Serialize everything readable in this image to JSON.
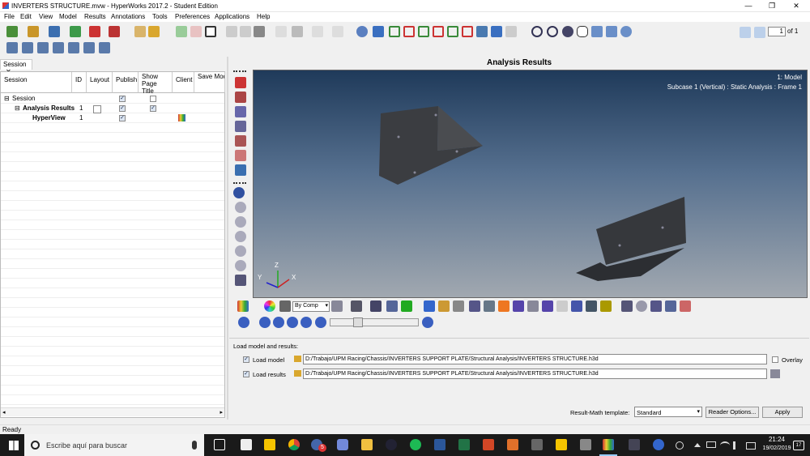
{
  "window": {
    "title": "INVERTERS STRUCTURE.mvw - HyperWorks 2017.2 - Student Edition",
    "min": "—",
    "max": "❐",
    "close": "✕"
  },
  "menu": [
    "File",
    "Edit",
    "View",
    "Model",
    "Results",
    "Annotations",
    "Tools",
    "Preferences",
    "Applications",
    "Help"
  ],
  "toolbar": {
    "page_current": "1",
    "page_total": "of 1"
  },
  "session": {
    "tab": "Session",
    "tab_close": "✕",
    "columns": [
      "Session",
      "ID",
      "Layout",
      "Publish",
      "Show Page Title",
      "Client",
      "Save Model File"
    ],
    "rows": [
      {
        "name": "Session",
        "id": "",
        "layout": null,
        "publish": true,
        "show_title": false,
        "client": ""
      },
      {
        "name": "Analysis Results",
        "id": "1",
        "layout": false,
        "publish": true,
        "show_title": true,
        "client": ""
      },
      {
        "name": "HyperView",
        "id": "1",
        "layout": null,
        "publish": true,
        "show_title": null,
        "client": "hv"
      }
    ],
    "tree_expander": "⊟"
  },
  "graphics": {
    "title": "Analysis Results",
    "model_label": "1: Model",
    "subcase_label": "Subcase 1 (Vertical) : Static Analysis : Frame 1",
    "axis_x": "X",
    "axis_y": "Y",
    "axis_z": "Z"
  },
  "results_toolbar": {
    "comp_select": "By Comp"
  },
  "load": {
    "header": "Load model and results:",
    "model_label": "Load model",
    "model_checked": true,
    "model_path": "D:/Trabajo/UPM Racing/Chassis/INVERTERS SUPPORT PLATE/Structural Analysis/INVERTERS STRUCTURE.h3d",
    "results_label": "Load results",
    "results_checked": true,
    "results_path": "D:/Trabajo/UPM Racing/Chassis/INVERTERS SUPPORT PLATE/Structural Analysis/INVERTERS STRUCTURE.h3d",
    "overlay_label": "Overlay",
    "math_label": "Result-Math template:",
    "math_value": "Standard",
    "reader_button": "Reader Options...",
    "apply_button": "Apply"
  },
  "status": "Ready",
  "taskbar": {
    "search_placeholder": "Escribe aquí para buscar",
    "time": "21:24",
    "date": "19/02/2019",
    "chrome_badge": "5",
    "notif_count": "17"
  }
}
